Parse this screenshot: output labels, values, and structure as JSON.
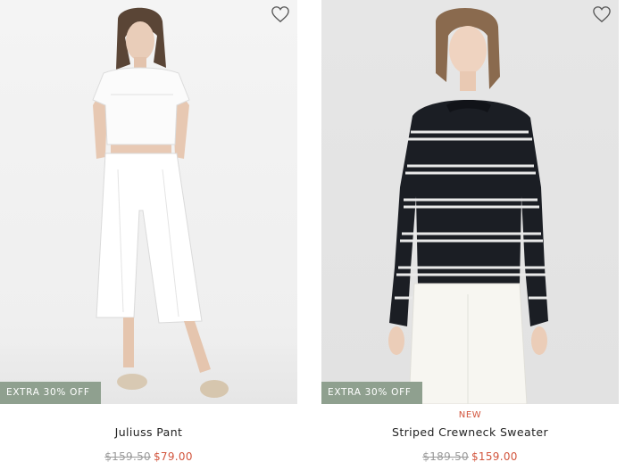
{
  "products": [
    {
      "badge": "EXTRA 30% OFF",
      "new_label": "",
      "name": "Juliuss Pant",
      "original_price": "$159.50",
      "sale_price": "$79.00"
    },
    {
      "badge": "EXTRA 30% OFF",
      "new_label": "NEW",
      "name": "Striped Crewneck Sweater",
      "original_price": "$189.50",
      "sale_price": "$159.00"
    }
  ],
  "icons": {
    "wishlist": "heart-outline-icon"
  },
  "colors": {
    "badge_bg": "#8fa08f",
    "sale_price": "#d2553d",
    "new_label": "#d2553d",
    "original_price": "#9a9a9a"
  }
}
